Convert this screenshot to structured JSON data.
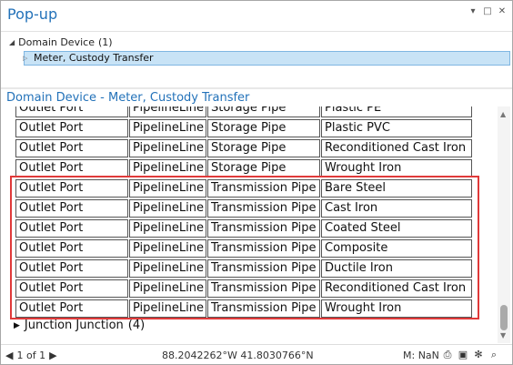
{
  "pane": {
    "title": "Pop-up"
  },
  "tree": {
    "root_label": "Domain Device",
    "root_count": "(1)",
    "selected_item": "Meter, Custody Transfer"
  },
  "detail": {
    "title": "Domain Device - Meter, Custody Transfer"
  },
  "table": {
    "rows": [
      [
        "Outlet Port",
        "PipelineLine",
        "Storage Pipe",
        "Plastic PE"
      ],
      [
        "Outlet Port",
        "PipelineLine",
        "Storage Pipe",
        "Plastic PVC"
      ],
      [
        "Outlet Port",
        "PipelineLine",
        "Storage Pipe",
        "Reconditioned Cast Iron"
      ],
      [
        "Outlet Port",
        "PipelineLine",
        "Storage Pipe",
        "Wrought Iron"
      ],
      [
        "Outlet Port",
        "PipelineLine",
        "Transmission Pipe",
        "Bare Steel"
      ],
      [
        "Outlet Port",
        "PipelineLine",
        "Transmission Pipe",
        "Cast Iron"
      ],
      [
        "Outlet Port",
        "PipelineLine",
        "Transmission Pipe",
        "Coated Steel"
      ],
      [
        "Outlet Port",
        "PipelineLine",
        "Transmission Pipe",
        "Composite"
      ],
      [
        "Outlet Port",
        "PipelineLine",
        "Transmission Pipe",
        "Ductile Iron"
      ],
      [
        "Outlet Port",
        "PipelineLine",
        "Transmission Pipe",
        "Reconditioned Cast Iron"
      ],
      [
        "Outlet Port",
        "PipelineLine",
        "Transmission Pipe",
        "Wrought Iron"
      ]
    ],
    "highlighted_rows": [
      4,
      5,
      6,
      7,
      8,
      9,
      10
    ]
  },
  "junction": {
    "label": "Junction Junction",
    "count": "(4)"
  },
  "status": {
    "page": "1 of 1",
    "coordinates": "88.2042262°W 41.8030766°N",
    "measure": "M: NaN"
  },
  "colors": {
    "accent": "#2372b9",
    "highlight": "#e03a3a",
    "selection": "#c8e3f6"
  }
}
